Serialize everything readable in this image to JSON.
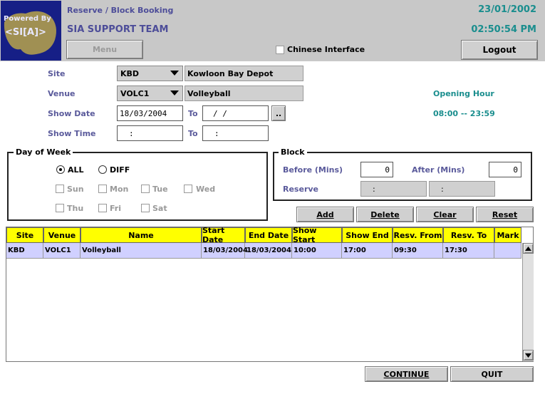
{
  "header": {
    "logo_text_line1": "Powered By",
    "logo_text_line2": "<SI[A]>",
    "breadcrumb": "Reserve / Block Booking",
    "team": "SIA SUPPORT TEAM",
    "date": "23/01/2002",
    "time": "02:50:54 PM",
    "menu_label": "Menu",
    "chinese_label": "Chinese Interface",
    "logout_label": "Logout"
  },
  "form": {
    "site_label": "Site",
    "site_code": "KBD",
    "site_name": "Kowloon Bay Depot",
    "venue_label": "Venue",
    "venue_code": "VOLC1",
    "venue_name": "Volleyball",
    "show_date_label": "Show Date",
    "show_date_from": "18/03/2004",
    "to_label": "To",
    "show_date_to": " /  /",
    "browse_label": "..",
    "show_time_label": "Show Time",
    "show_time_from": ":",
    "show_time_to": ":",
    "opening_hour_label": "Opening Hour",
    "opening_hour_value": "08:00 -- 23:59"
  },
  "day_of_week": {
    "title": "Day of Week",
    "all_label": "ALL",
    "diff_label": "DIFF",
    "days": [
      "Sun",
      "Mon",
      "Tue",
      "Wed",
      "Thu",
      "Fri",
      "Sat"
    ]
  },
  "block": {
    "title": "Block",
    "before_label": "Before (Mins)",
    "before_value": "0",
    "after_label": "After (Mins)",
    "after_value": "0",
    "reserve_label": "Reserve",
    "reserve_from": ":",
    "reserve_to": ":"
  },
  "actions": {
    "add": "Add",
    "delete": "Delete",
    "clear": "Clear",
    "reset": "Reset"
  },
  "table": {
    "columns": [
      "Site",
      "Venue",
      "Name",
      "Start Date",
      "End Date",
      "Show Start",
      "Show End",
      "Resv. From",
      "Resv. To",
      "Mark"
    ],
    "rows": [
      [
        "KBD",
        "VOLC1",
        "Volleyball",
        "18/03/2004",
        "18/03/2004",
        "10:00",
        "17:00",
        "09:30",
        "17:30",
        ""
      ]
    ]
  },
  "footer": {
    "continue": "CONTINUE",
    "quit": "QUIT"
  },
  "colors": {
    "header_bg": "#c8c8c8",
    "logo_bg": "#161f86",
    "label_blue": "#5a5a9b",
    "teal": "#1a8e8e",
    "table_header": "#ffff00",
    "row_selected": "#d0d0ff"
  }
}
